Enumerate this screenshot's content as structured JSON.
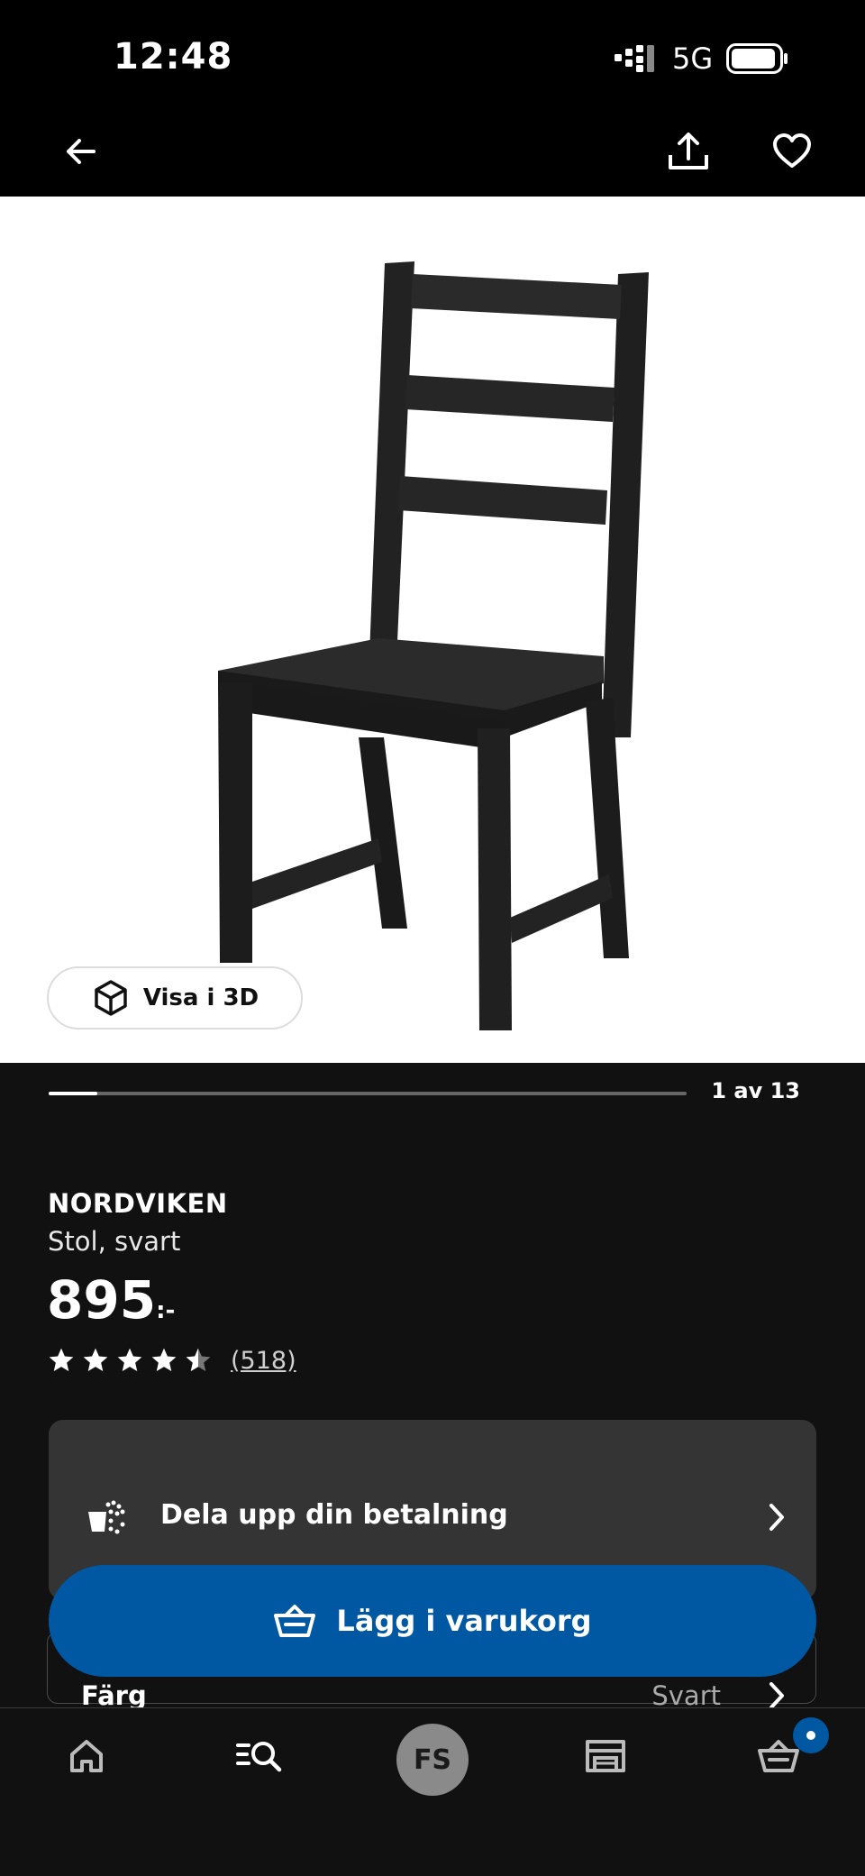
{
  "status_bar": {
    "time": "12:48",
    "network": "5G"
  },
  "top_nav": {
    "back_icon": "arrow-left-icon",
    "share_icon": "share-icon",
    "favorite_icon": "heart-icon"
  },
  "gallery": {
    "view_3d_label": "Visa i 3D",
    "counter": "1 av 13",
    "current_index": 1,
    "total_images": 13
  },
  "product": {
    "name": "NORDVIKEN",
    "description": "Stol, svart",
    "price": "895",
    "price_suffix": ":-",
    "rating": 4.5,
    "reviews": "(518)"
  },
  "payment": {
    "label": "Dela upp din betalning"
  },
  "options": {
    "color_label": "Färg",
    "color_value": "Svart"
  },
  "add_to_cart": {
    "label": "Lägg i varukorg"
  },
  "bottom_nav": {
    "tabs": [
      "home-icon",
      "search-list-icon",
      "profile-avatar",
      "store-icon",
      "cart-icon"
    ],
    "avatar_initials": "FS"
  },
  "colors": {
    "accent": "#0058a3",
    "background": "#111111",
    "card": "#343434"
  }
}
